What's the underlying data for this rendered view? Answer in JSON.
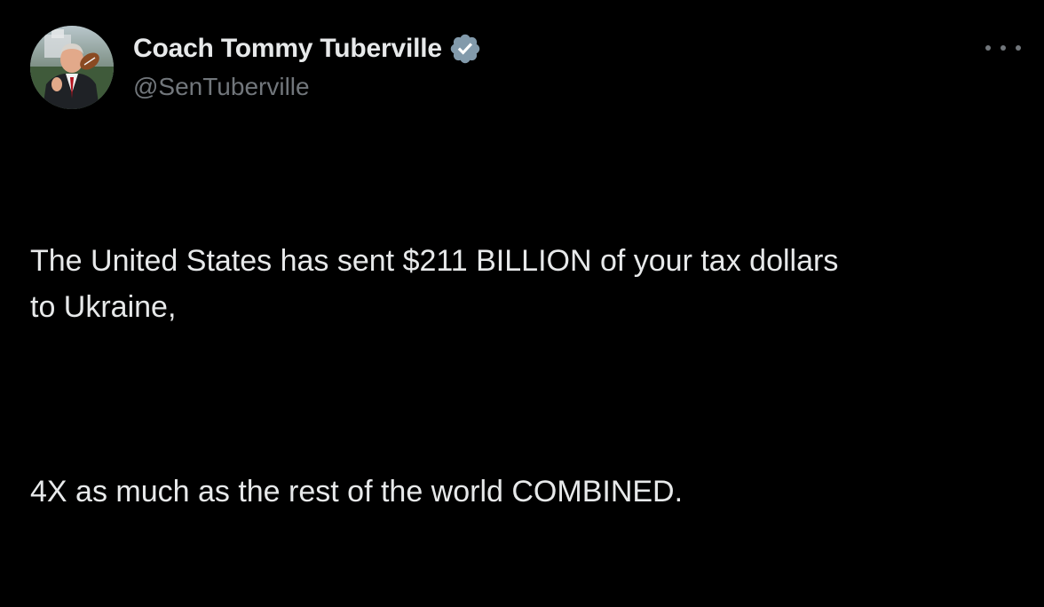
{
  "tweet": {
    "author": {
      "display_name": "Coach Tommy Tuberville",
      "handle": "@SenTuberville",
      "verified": true,
      "verified_color": "#829aab"
    },
    "more_icon": "more-horizontal-icon",
    "paragraphs": [
      "The United States has sent $211 BILLION of your tax dollars\nto Ukraine,",
      "4X as much as the rest of the world COMBINED."
    ]
  }
}
